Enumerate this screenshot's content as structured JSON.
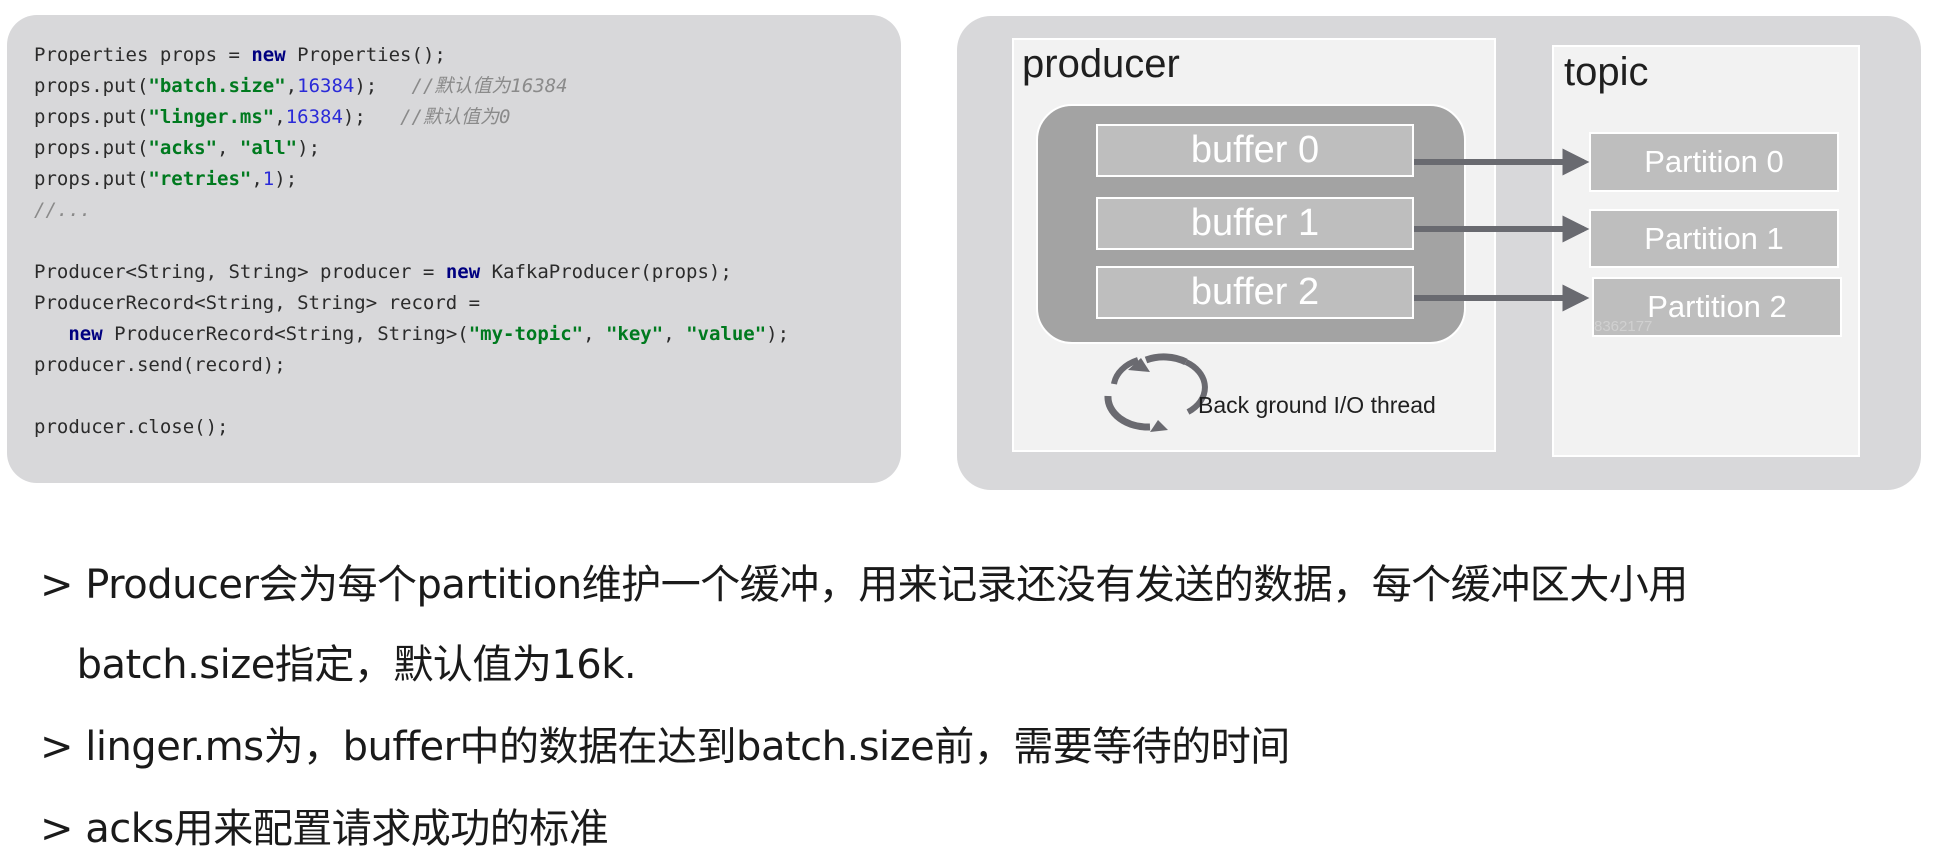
{
  "code": {
    "lines": [
      [
        {
          "t": "Properties props = ",
          "c": "plain"
        },
        {
          "t": "new",
          "c": "kw"
        },
        {
          "t": " Properties();",
          "c": "plain"
        }
      ],
      [
        {
          "t": "props.put(",
          "c": "plain"
        },
        {
          "t": "\"batch.size\"",
          "c": "str"
        },
        {
          "t": ",",
          "c": "plain"
        },
        {
          "t": "16384",
          "c": "num"
        },
        {
          "t": ");   ",
          "c": "plain"
        },
        {
          "t": "//默认值为16384",
          "c": "com"
        }
      ],
      [
        {
          "t": "props.put(",
          "c": "plain"
        },
        {
          "t": "\"linger.ms\"",
          "c": "str"
        },
        {
          "t": ",",
          "c": "plain"
        },
        {
          "t": "16384",
          "c": "num"
        },
        {
          "t": ");   ",
          "c": "plain"
        },
        {
          "t": "//默认值为0",
          "c": "com"
        }
      ],
      [
        {
          "t": "props.put(",
          "c": "plain"
        },
        {
          "t": "\"acks\"",
          "c": "str"
        },
        {
          "t": ", ",
          "c": "plain"
        },
        {
          "t": "\"all\"",
          "c": "str"
        },
        {
          "t": ");",
          "c": "plain"
        }
      ],
      [
        {
          "t": "props.put(",
          "c": "plain"
        },
        {
          "t": "\"retries\"",
          "c": "str"
        },
        {
          "t": ",",
          "c": "plain"
        },
        {
          "t": "1",
          "c": "num"
        },
        {
          "t": ");",
          "c": "plain"
        }
      ],
      [
        {
          "t": "//...",
          "c": "com"
        }
      ],
      [],
      [
        {
          "t": "Producer<String, String> producer = ",
          "c": "plain"
        },
        {
          "t": "new",
          "c": "kw"
        },
        {
          "t": " KafkaProducer(props);",
          "c": "plain"
        }
      ],
      [
        {
          "t": "ProducerRecord<String, String> record =",
          "c": "plain"
        }
      ],
      [
        {
          "t": "   ",
          "c": "plain"
        },
        {
          "t": "new",
          "c": "kw"
        },
        {
          "t": " ProducerRecord<String, String>(",
          "c": "plain"
        },
        {
          "t": "\"my-topic\"",
          "c": "str"
        },
        {
          "t": ", ",
          "c": "plain"
        },
        {
          "t": "\"key\"",
          "c": "str"
        },
        {
          "t": ", ",
          "c": "plain"
        },
        {
          "t": "\"value\"",
          "c": "str"
        },
        {
          "t": ");",
          "c": "plain"
        }
      ],
      [
        {
          "t": "producer.send(record);",
          "c": "plain"
        }
      ],
      [],
      [
        {
          "t": "producer.close();",
          "c": "plain"
        }
      ]
    ]
  },
  "diagram": {
    "producer_title": "producer",
    "topic_title": "topic",
    "buffers": [
      "buffer 0",
      "buffer 1",
      "buffer 2"
    ],
    "partitions": [
      "Partition 0",
      "Partition 1",
      "Partition 2"
    ],
    "thread_label": "Back ground I/O thread",
    "watermark": "8362177"
  },
  "notes": [
    "> Producer会为每个partition维护一个缓冲，用来记录还没有发送的数据，每个缓冲区大小用",
    "   batch.size指定，默认值为16k.",
    "> linger.ms为，buffer中的数据在达到batch.size前，需要等待的时间",
    "> acks用来配置请求成功的标准"
  ]
}
